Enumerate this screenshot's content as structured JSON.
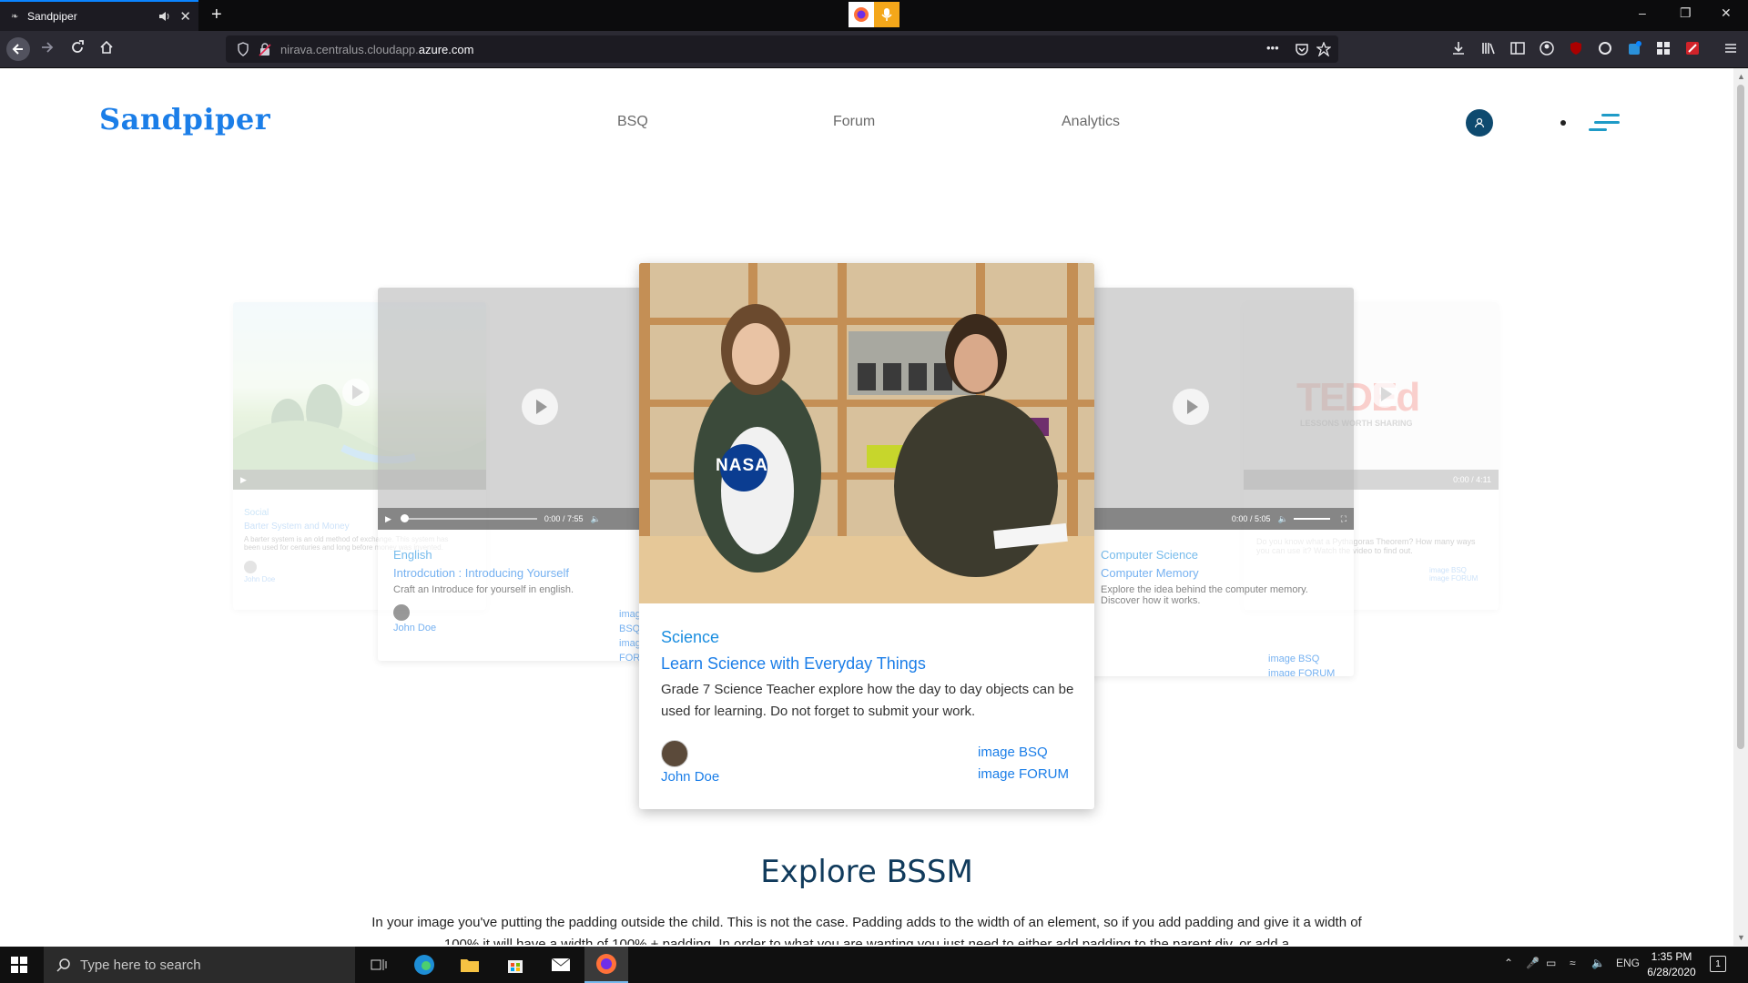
{
  "browser": {
    "tab_title": "Sandpiper",
    "new_tab_label": "+",
    "url_prefix": "nirava.centralus.cloudapp.",
    "url_domain": "azure.com",
    "url_more": "•••"
  },
  "header": {
    "logo": "Sandpiper",
    "nav": [
      "BSQ",
      "Forum",
      "Analytics"
    ]
  },
  "cards": {
    "far_left": {
      "category": "Social",
      "title": "Barter System and Money",
      "description": "A barter system is an old method of exchange. This system has been used for centuries and long before money was invented.",
      "author": "John Doe"
    },
    "left": {
      "time": "0:00 / 7:55",
      "category": "English",
      "title": "Introdcution : Introducing Yourself",
      "description": "Craft an Introduce for yourself in english.",
      "author": "John Doe",
      "link1": "image BSQ",
      "link2": "image FORUM"
    },
    "center": {
      "category": "Science",
      "title": "Learn Science with Everyday Things",
      "description": "Grade 7 Science Teacher explore how the day to day objects can be used for learning. Do not forget to submit your work.",
      "author": "John Doe",
      "link1": "image BSQ",
      "link2": "image FORUM",
      "shirt_text": "NASA"
    },
    "right": {
      "time": "0:00 / 5:05",
      "category": "Computer Science",
      "title": "Computer Memory",
      "description": "Explore the idea behind the computer memory. Discover how it works.",
      "link1": "image BSQ",
      "link2": "image FORUM"
    },
    "far_right": {
      "logo_text": "TEDEd",
      "logo_sub": "LESSONS WORTH SHARING",
      "time": "0:00 / 4:11",
      "description": "Do you know what a Pythagoras Theorem? How many ways you can use it? Watch the video to find out.",
      "link1": "image BSQ",
      "link2": "image FORUM"
    }
  },
  "explore": {
    "heading": "Explore BSSM",
    "paragraph": "In your image you've putting the padding outside the child. This is not the case. Padding adds to the width of an element, so if you add padding and give it a width of 100% it will have a width of 100% + padding. In order to what you are wanting you just need to either add padding to the parent div, or add a"
  },
  "taskbar": {
    "search_placeholder": "Type here to search",
    "lang": "ENG",
    "time": "1:35 PM",
    "date": "6/28/2020",
    "notif_count": "1"
  },
  "colors": {
    "brand": "#1b7ee8",
    "avatar_bg": "#0e4a6f",
    "menu_accent": "#1f9bc7"
  }
}
